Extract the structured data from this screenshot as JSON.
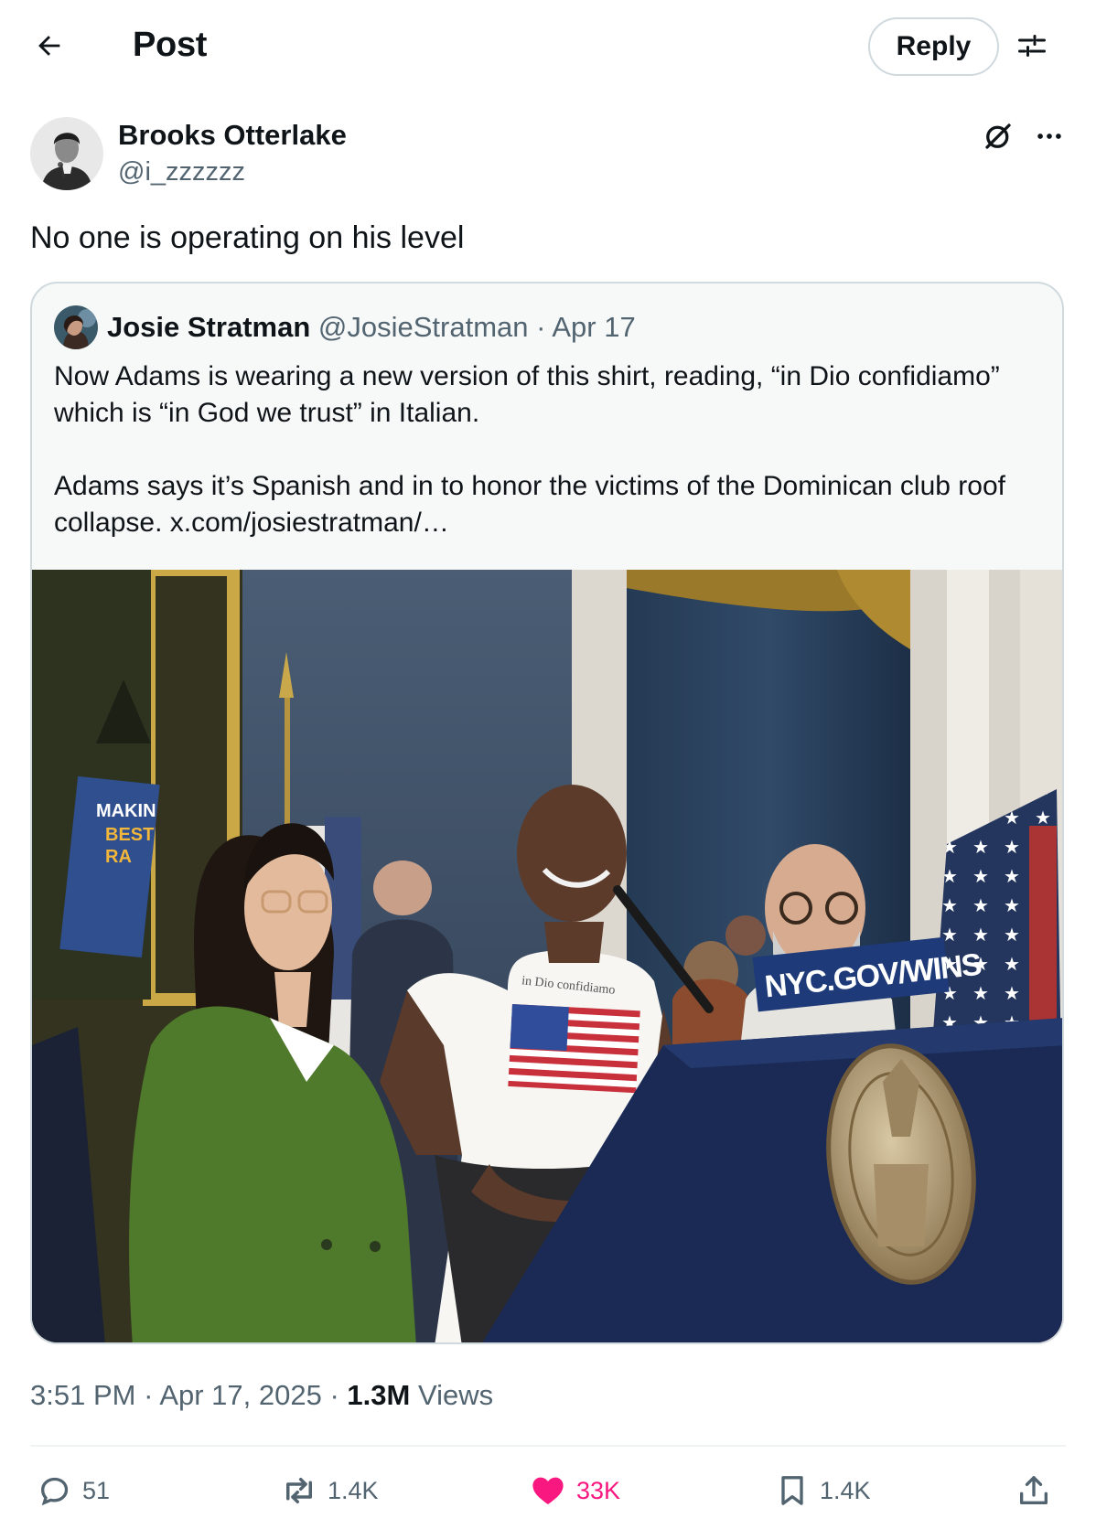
{
  "header": {
    "title": "Post",
    "reply_label": "Reply"
  },
  "post": {
    "author_name": "Brooks Otterlake",
    "author_handle": "@i_zzzzzz",
    "text": "No one is operating on his level",
    "time": "3:51 PM",
    "date": "Apr 17, 2025",
    "views_count": "1.3M",
    "views_label": "Views",
    "separator": "·"
  },
  "quote": {
    "author_name": "Josie Stratman",
    "author_handle": "@JosieStratman",
    "separator": "·",
    "date": "Apr 17",
    "paragraph_1": "Now Adams is wearing a new version of this shirt, reading, “in Dio confidiamo” which is “in God we trust” in Italian.",
    "paragraph_2": "Adams says it’s Spanish and in to honor the victims of the Dominican club roof collapse.  x.com/josiestratman/…",
    "image": {
      "sign_text": [
        "MAKIN",
        "BEST",
        "RA"
      ],
      "shirt_text": "in Dio confidiamo",
      "podium_text": "NYC.GOV/WINS"
    }
  },
  "actions": {
    "replies": "51",
    "reposts": "1.4K",
    "likes": "33K",
    "bookmarks": "1.4K"
  },
  "colors": {
    "text": "#0f1419",
    "secondary": "#536471",
    "border": "#cfd9de",
    "like": "#f91880"
  },
  "icons": [
    "back-arrow-icon",
    "adjust-icon",
    "grok-icon",
    "more-icon",
    "reply-icon",
    "repost-icon",
    "heart-icon",
    "bookmark-icon",
    "share-icon"
  ]
}
